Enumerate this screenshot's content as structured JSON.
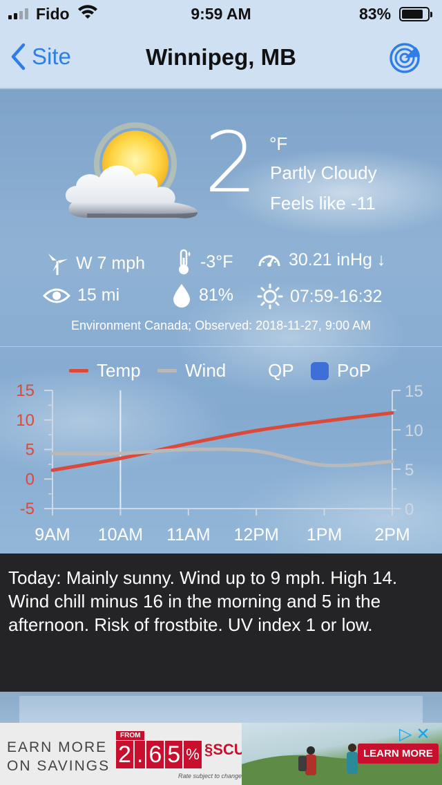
{
  "status_bar": {
    "carrier": "Fido",
    "time": "9:59 AM",
    "battery_pct": "83%",
    "battery_level": 0.83,
    "signal_bars": 4,
    "signal_active": 2
  },
  "nav": {
    "back_label": "Site",
    "title": "Winnipeg, MB",
    "radar_icon": "radar-icon"
  },
  "current": {
    "temperature": "2",
    "unit": "°F",
    "condition": "Partly Cloudy",
    "feels_like": "Feels like -11",
    "condition_icon": "partly-cloudy-icon"
  },
  "details": {
    "wind": "W 7 mph",
    "dew_point": "-3°F",
    "pressure": "30.21 inHg ↓",
    "visibility": "15 mi",
    "humidity": "81%",
    "sun_times": "07:59-16:32"
  },
  "source": "Environment Canada; Observed: 2018-11-27, 9:00 AM",
  "legend": {
    "temp": "Temp",
    "wind": "Wind",
    "qp": "QP",
    "pop": "PoP"
  },
  "colors": {
    "temp": "#d94a3a",
    "wind": "#b9b9b9",
    "pop": "#3d6fd6",
    "axis_left": "#d94a3a",
    "axis_right": "#cfd8e2",
    "accent": "#2f7ee6"
  },
  "chart_data": {
    "type": "line",
    "categories": [
      "9AM",
      "10AM",
      "11AM",
      "12PM",
      "1PM",
      "2PM"
    ],
    "x": [
      0,
      1,
      2,
      3,
      4,
      5
    ],
    "series": [
      {
        "name": "Temp",
        "axis": "left",
        "values": [
          1.5,
          3.5,
          6,
          8.2,
          9.8,
          11.2
        ]
      },
      {
        "name": "Wind",
        "axis": "right",
        "values": [
          7,
          7,
          7.5,
          7.3,
          5.5,
          6
        ]
      }
    ],
    "y_left": {
      "ylim": [
        -5,
        15
      ],
      "ticks": [
        "15",
        "10",
        "5",
        "0",
        "-5"
      ],
      "tick_values": [
        15,
        10,
        5,
        0,
        -5
      ]
    },
    "y_right": {
      "ylim": [
        0,
        15
      ],
      "ticks": [
        "15",
        "10",
        "5",
        "0"
      ],
      "tick_values": [
        15,
        10,
        5,
        0
      ]
    },
    "grid": false
  },
  "forecast_text": "Today:  Mainly sunny. Wind up to 9 mph. High 14. Wind chill minus 16 in the morning and 5 in the afternoon. Risk of frostbite. UV index 1 or low.",
  "ad": {
    "headline_1": "EARN MORE",
    "headline_2": "ON SAVINGS",
    "from_label": "FROM",
    "rate_digits": [
      "2",
      ".",
      "6",
      "5",
      "%"
    ],
    "rate_note": "Rate subject to change",
    "brand": "SCU",
    "cta": "LEARN MORE",
    "adchoices_icon": "adchoices-icon",
    "close_icon": "close-icon"
  }
}
